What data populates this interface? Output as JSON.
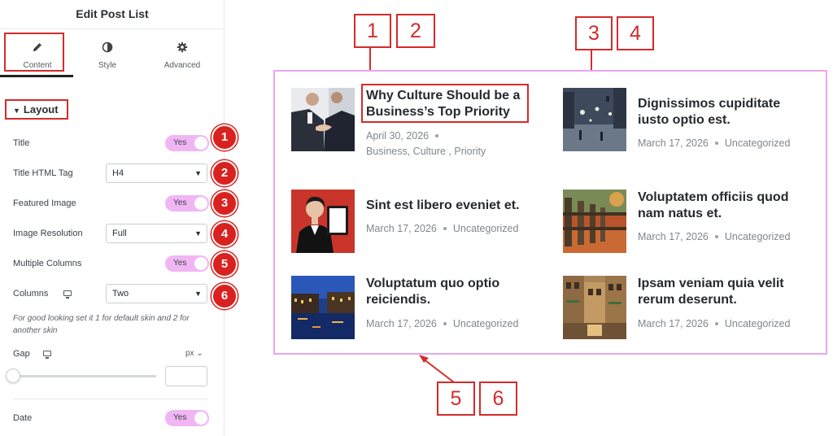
{
  "panel": {
    "title": "Edit Post List",
    "tabs": [
      {
        "label": "Content",
        "icon": "pencil-icon",
        "active": true
      },
      {
        "label": "Style",
        "icon": "contrast-icon",
        "active": false
      },
      {
        "label": "Advanced",
        "icon": "gear-icon",
        "active": false
      }
    ],
    "section_label": "Layout",
    "controls": {
      "title": {
        "label": "Title",
        "value": "Yes"
      },
      "title_html_tag": {
        "label": "Title HTML Tag",
        "value": "H4"
      },
      "featured_image": {
        "label": "Featured Image",
        "value": "Yes"
      },
      "image_resolution": {
        "label": "Image Resolution",
        "value": "Full"
      },
      "multiple_columns": {
        "label": "Multiple Columns",
        "value": "Yes"
      },
      "columns": {
        "label": "Columns",
        "value": "Two"
      },
      "columns_hint": "For good looking set it 1 for default skin and 2 for another skin",
      "gap": {
        "label": "Gap",
        "unit": "px",
        "value": ""
      },
      "date": {
        "label": "Date",
        "value": "Yes"
      }
    },
    "badges": [
      "1",
      "2",
      "3",
      "4",
      "5",
      "6"
    ]
  },
  "annotations": {
    "top_left": [
      "1",
      "2"
    ],
    "top_right": [
      "3",
      "4"
    ],
    "bottom": [
      "5",
      "6"
    ],
    "accent_color": "#d42b2b"
  },
  "preview": {
    "border_color": "#eaa6ee",
    "posts": [
      {
        "title_line1": "Why Culture Should be a",
        "title_line2": "Business’s Top Priority",
        "date": "April 30, 2026",
        "categories": "Business, Culture , Priority",
        "image": "handshake"
      },
      {
        "title_line1": "Dignissimos cupiditate",
        "title_line2": "iusto optio est.",
        "date": "March 17, 2026",
        "categories": "Uncategorized",
        "image": "winter-street"
      },
      {
        "title_line1": "Sint est libero eveniet et.",
        "title_line2": "",
        "date": "March 17, 2026",
        "categories": "Uncategorized",
        "image": "woman-tablet"
      },
      {
        "title_line1": "Voluptatem officiis quod",
        "title_line2": "nam natus et.",
        "date": "March 17, 2026",
        "categories": "Uncategorized",
        "image": "wooden-fence"
      },
      {
        "title_line1": "Voluptatum quo optio",
        "title_line2": "reiciendis.",
        "date": "March 17, 2026",
        "categories": "Uncategorized",
        "image": "canal-night"
      },
      {
        "title_line1": "Ipsam veniam quia velit",
        "title_line2": "rerum deserunt.",
        "date": "March 17, 2026",
        "categories": "Uncategorized",
        "image": "city-buildings"
      }
    ]
  }
}
